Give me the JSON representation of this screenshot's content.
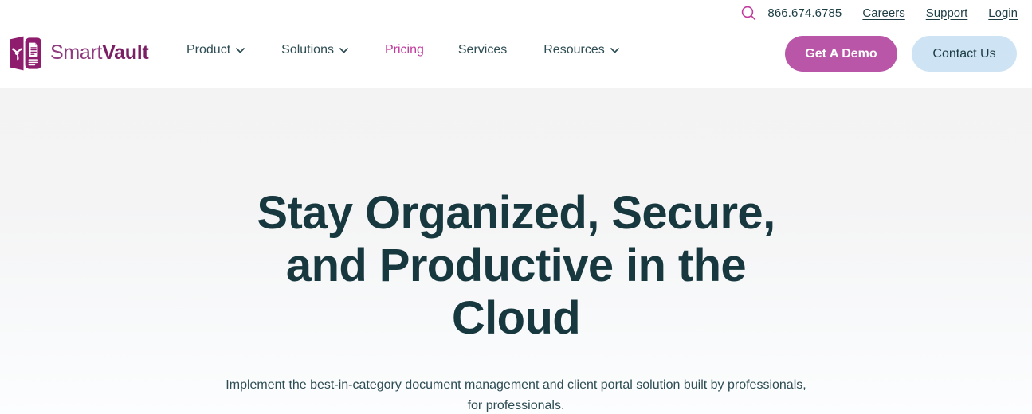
{
  "brand": {
    "logo_icon": "smartvault-vault-document-logo",
    "name_part1": "Smart",
    "name_part2": "Vault",
    "colors": {
      "accent_magenta": "#c0399c",
      "button_magenta": "#ba56a8",
      "button_lightblue": "#cee4f4",
      "dark_teal": "#17383e",
      "logo_purple_light": "#8e3a7e",
      "logo_purple_dark": "#7a1f63",
      "hero_background": "#f3f3f4"
    }
  },
  "utility_bar": {
    "search_icon": "search-icon",
    "phone": "866.674.6785",
    "links": [
      {
        "label": "Careers"
      },
      {
        "label": "Support"
      },
      {
        "label": "Login"
      }
    ]
  },
  "nav": {
    "items": [
      {
        "label": "Product",
        "has_dropdown": true,
        "active": false,
        "icon": "chevron-down-icon"
      },
      {
        "label": "Solutions",
        "has_dropdown": true,
        "active": false,
        "icon": "chevron-down-icon"
      },
      {
        "label": "Pricing",
        "has_dropdown": false,
        "active": true,
        "icon": ""
      },
      {
        "label": "Services",
        "has_dropdown": false,
        "active": false,
        "icon": ""
      },
      {
        "label": "Resources",
        "has_dropdown": true,
        "active": false,
        "icon": "chevron-down-icon"
      }
    ]
  },
  "cta": {
    "demo_label": "Get A Demo",
    "contact_label": "Contact Us"
  },
  "hero": {
    "title": "Stay Organized, Secure, and Productive in the Cloud",
    "subtitle": "Implement the best-in-category document management and client portal solution built by professionals, for professionals."
  }
}
